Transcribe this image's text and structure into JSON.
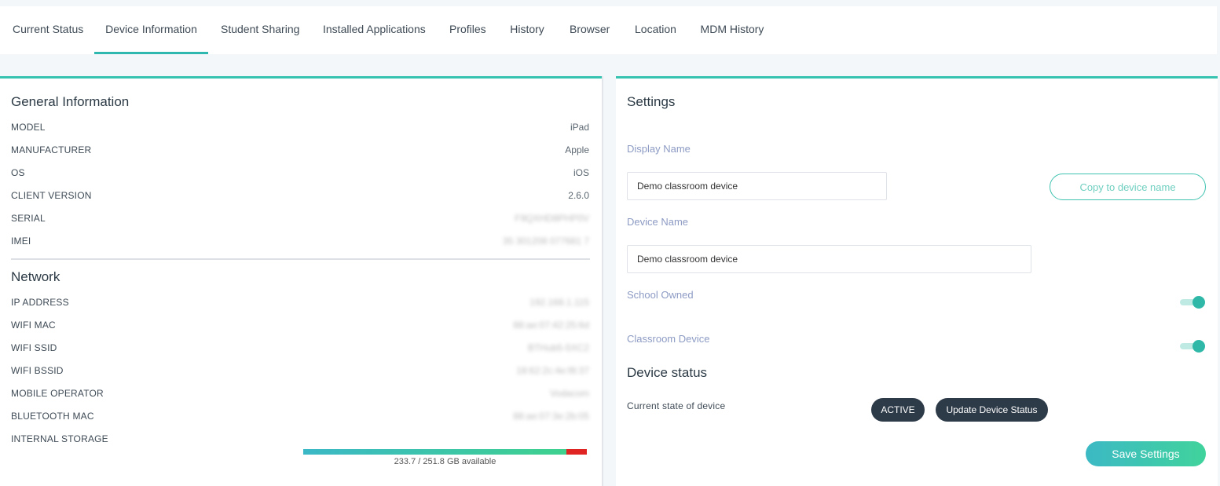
{
  "tabs": [
    {
      "label": "Current Status"
    },
    {
      "label": "Device Information"
    },
    {
      "label": "Student Sharing"
    },
    {
      "label": "Installed Applications"
    },
    {
      "label": "Profiles"
    },
    {
      "label": "History"
    },
    {
      "label": "Browser"
    },
    {
      "label": "Location"
    },
    {
      "label": "MDM History"
    }
  ],
  "general": {
    "title": "General Information",
    "rows": [
      {
        "label": "MODEL",
        "value": "iPad"
      },
      {
        "label": "MANUFACTURER",
        "value": "Apple"
      },
      {
        "label": "OS",
        "value": "iOS"
      },
      {
        "label": "CLIENT VERSION",
        "value": "2.6.0"
      },
      {
        "label": "SERIAL",
        "value": "F9QXHD8PHP0V"
      },
      {
        "label": "IMEI",
        "value": "35 301208 077681 7"
      }
    ]
  },
  "network": {
    "title": "Network",
    "rows": [
      {
        "label": "IP ADDRESS",
        "value": "192.168.1.115"
      },
      {
        "label": "WIFI MAC",
        "value": "88:ae:07:42:25:6d"
      },
      {
        "label": "WIFI SSID",
        "value": "BTHub5-5XC2"
      },
      {
        "label": "WIFI BSSID",
        "value": "18:62:2c:4e:f8:37"
      },
      {
        "label": "MOBILE OPERATOR",
        "value": "Vodacom"
      },
      {
        "label": "BLUETOOTH MAC",
        "value": "88:ae:07:3e:2b:05"
      },
      {
        "label": "INTERNAL STORAGE",
        "value": ""
      }
    ],
    "storage": {
      "text": "233.7 / 251.8 GB available",
      "available_fraction": 0.928
    }
  },
  "settings": {
    "title": "Settings",
    "display_name_label": "Display Name",
    "display_name_value": "Demo classroom device",
    "copy_button": "Copy to device name",
    "device_name_label": "Device Name",
    "device_name_value": "Demo classroom device",
    "school_owned_label": "School Owned",
    "school_owned_on": true,
    "classroom_device_label": "Classroom Device",
    "classroom_device_on": true
  },
  "device_status": {
    "title": "Device status",
    "state_label": "Current state of device",
    "state_value": "ACTIVE",
    "update_button": "Update Device Status"
  },
  "save_button": "Save Settings",
  "colors": {
    "accent": "#2fb8b0",
    "dark": "#2d3a48",
    "storage_used": "#e02424"
  }
}
